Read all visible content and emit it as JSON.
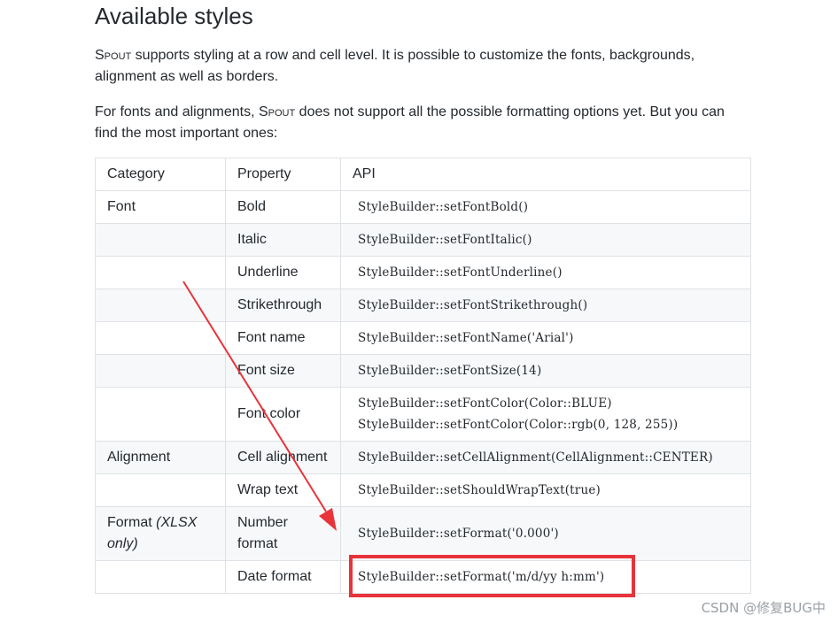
{
  "heading": "Available styles",
  "paragraphs": {
    "p1_brand": "Spout",
    "p1_text": " supports styling at a row and cell level. It is possible to customize the fonts, backgrounds, alignment as well as borders.",
    "p2_prefix": "For fonts and alignments, ",
    "p2_brand": "Spout",
    "p2_text": " does not support all the possible formatting options yet. But you can find the most important ones:"
  },
  "table": {
    "headers": [
      "Category",
      "Property",
      "API"
    ],
    "rows": [
      {
        "category": "Font",
        "category_note": "",
        "property": "Bold",
        "api": [
          "StyleBuilder::setFontBold()"
        ]
      },
      {
        "category": "",
        "category_note": "",
        "property": "Italic",
        "api": [
          "StyleBuilder::setFontItalic()"
        ]
      },
      {
        "category": "",
        "category_note": "",
        "property": "Underline",
        "api": [
          "StyleBuilder::setFontUnderline()"
        ]
      },
      {
        "category": "",
        "category_note": "",
        "property": "Strikethrough",
        "api": [
          "StyleBuilder::setFontStrikethrough()"
        ]
      },
      {
        "category": "",
        "category_note": "",
        "property": "Font name",
        "api": [
          "StyleBuilder::setFontName('Arial')"
        ]
      },
      {
        "category": "",
        "category_note": "",
        "property": "Font size",
        "api": [
          "StyleBuilder::setFontSize(14)"
        ]
      },
      {
        "category": "",
        "category_note": "",
        "property": "Font color",
        "api": [
          "StyleBuilder::setFontColor(Color::BLUE)",
          "StyleBuilder::setFontColor(Color::rgb(0, 128, 255))"
        ]
      },
      {
        "category": "Alignment",
        "category_note": "",
        "property": "Cell alignment",
        "api": [
          "StyleBuilder::setCellAlignment(CellAlignment::CENTER)"
        ]
      },
      {
        "category": "",
        "category_note": "",
        "property": "Wrap text",
        "api": [
          "StyleBuilder::setShouldWrapText(true)"
        ]
      },
      {
        "category": "Format ",
        "category_note": "(XLSX only)",
        "property": "Number format",
        "api": [
          "StyleBuilder::setFormat('0.000')"
        ]
      },
      {
        "category": "",
        "category_note": "",
        "property": "Date format",
        "api": [
          "StyleBuilder::setFormat('m/d/yy h:mm')"
        ]
      }
    ]
  },
  "annotation": {
    "color": "#e8333a"
  },
  "watermark": "CSDN @修复BUG中"
}
